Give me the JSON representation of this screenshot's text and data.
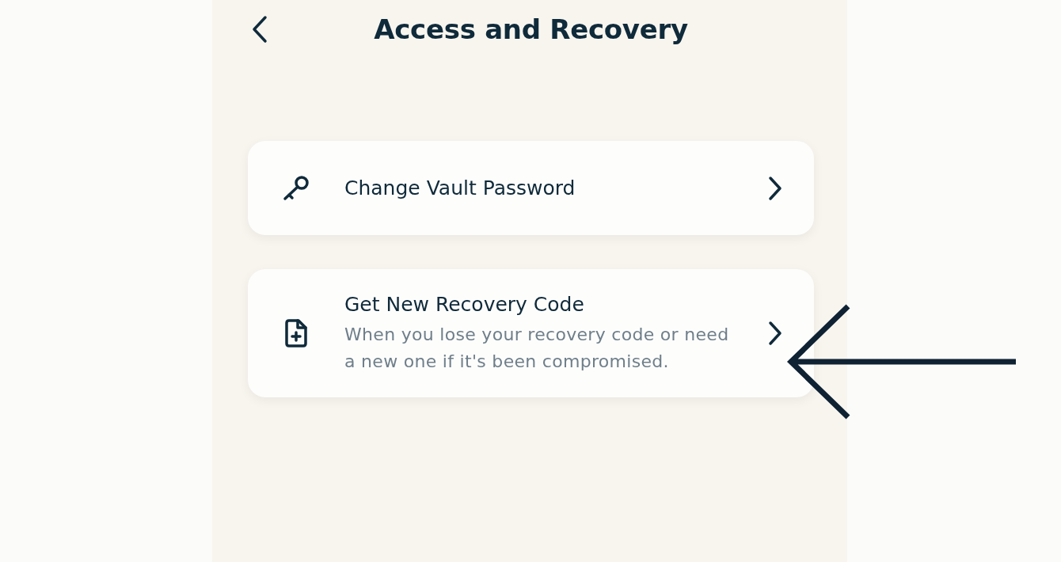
{
  "header": {
    "back": true,
    "title": "Access and Recovery"
  },
  "items": [
    {
      "title": "Change Vault Password"
    },
    {
      "title": "Get New Recovery Code",
      "subtitle": "When you lose your recovery code or need a new one if it's been compromised."
    }
  ],
  "annotation": {
    "kind": "arrow"
  }
}
